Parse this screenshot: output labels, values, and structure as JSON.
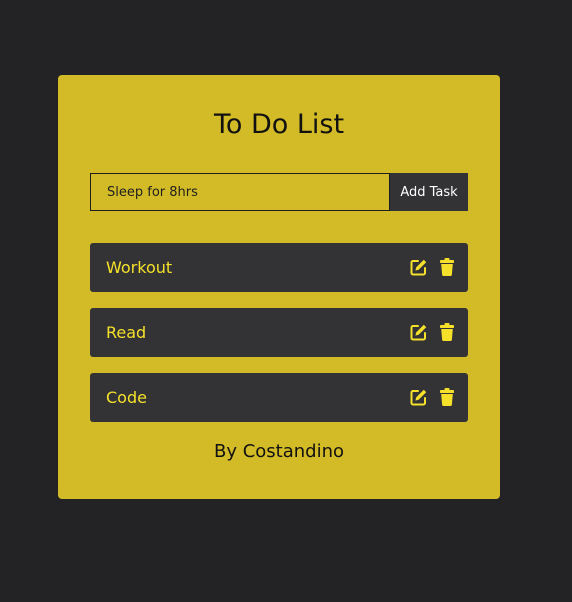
{
  "app": {
    "title": "To Do List",
    "footer": "By Costandino"
  },
  "input": {
    "value": "Sleep for 8hrs",
    "placeholder": ""
  },
  "add_button_label": "Add Task",
  "tasks": [
    {
      "label": "Workout"
    },
    {
      "label": "Read"
    },
    {
      "label": "Code"
    }
  ],
  "icons": {
    "edit": "edit-icon",
    "delete": "trash-icon"
  },
  "colors": {
    "page_background": "#232325",
    "card_background": "#d3bb27",
    "task_background": "#333336",
    "task_text": "#f5e12a",
    "icon": "#f5e12a"
  }
}
